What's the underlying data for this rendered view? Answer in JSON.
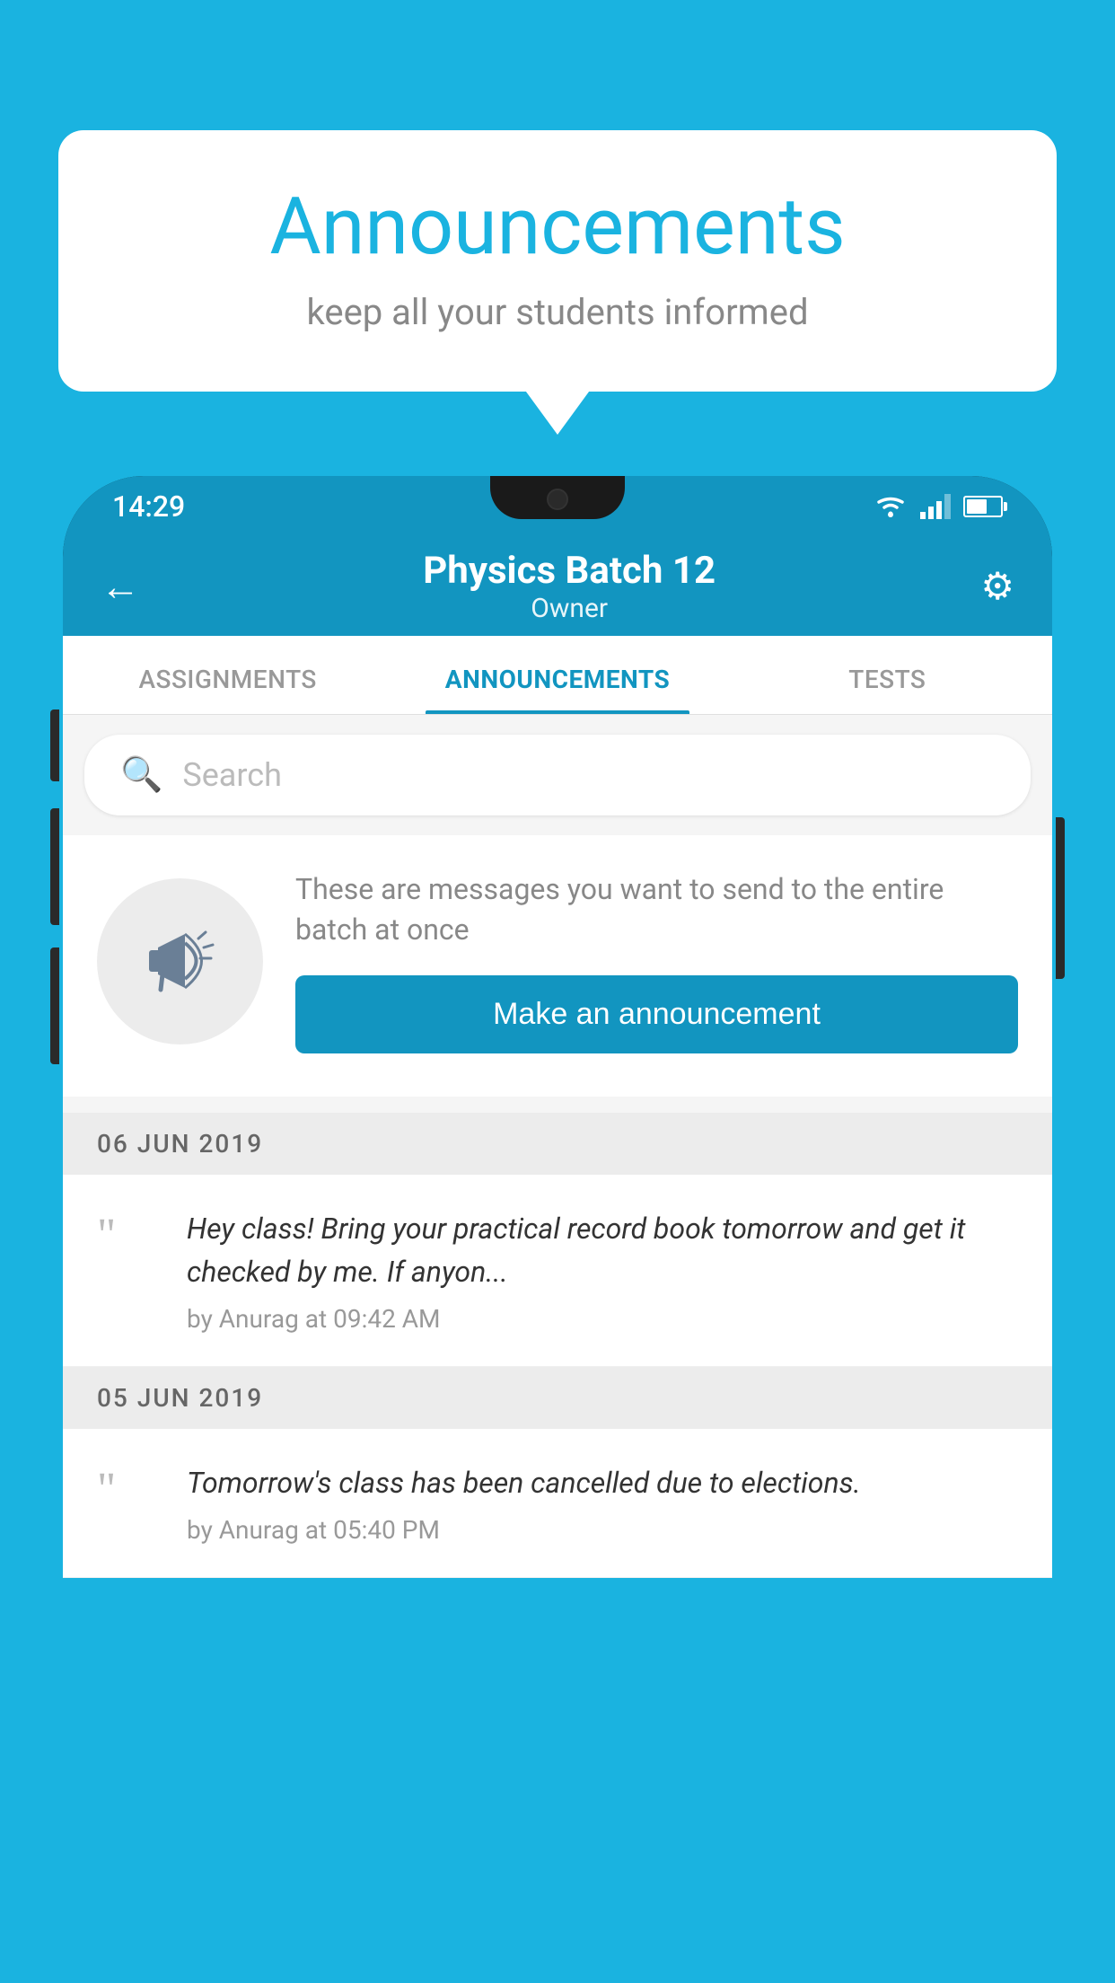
{
  "background_color": "#1ab3e0",
  "speech_bubble": {
    "title": "Announcements",
    "subtitle": "keep all your students informed"
  },
  "status_bar": {
    "time": "14:29",
    "wifi": true,
    "signal": true,
    "battery": true
  },
  "toolbar": {
    "title": "Physics Batch 12",
    "subtitle": "Owner",
    "back_label": "←",
    "gear_label": "⚙"
  },
  "tabs": [
    {
      "label": "ASSIGNMENTS",
      "active": false
    },
    {
      "label": "ANNOUNCEMENTS",
      "active": true
    },
    {
      "label": "TESTS",
      "active": false
    }
  ],
  "search": {
    "placeholder": "Search"
  },
  "promo": {
    "text": "These are messages you want to send to the entire batch at once",
    "button_label": "Make an announcement"
  },
  "announcements": [
    {
      "date": "06  JUN  2019",
      "text": "Hey class! Bring your practical record book tomorrow and get it checked by me. If anyon...",
      "meta": "by Anurag at 09:42 AM"
    },
    {
      "date": "05  JUN  2019",
      "text": "Tomorrow's class has been cancelled due to elections.",
      "meta": "by Anurag at 05:40 PM"
    }
  ]
}
